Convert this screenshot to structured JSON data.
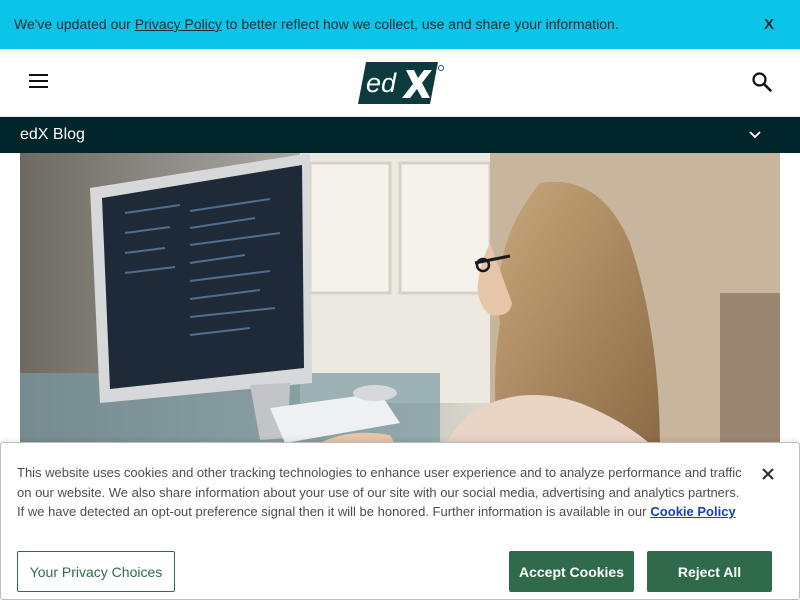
{
  "notice": {
    "text_before": "We've updated our ",
    "link": "Privacy Policy",
    "text_after": " to better reflect how we collect, use and share your information.",
    "close": "X"
  },
  "header": {
    "menu_icon": "hamburger-icon",
    "logo": "edX",
    "search_icon": "search-icon"
  },
  "blog_bar": {
    "title": "edX Blog",
    "chevron_icon": "chevron-down-icon"
  },
  "hero": {
    "icon": "photo-of-woman-at-computer"
  },
  "consent": {
    "text": "This website uses cookies and other tracking technologies to enhance user experience and to analyze performance and traffic on our website. We also share information about your use of our site with our social media, advertising and analytics partners. If we have detected an opt-out preference signal then it will be honored. Further information is available in our",
    "link": "Cookie Policy",
    "close_icon": "close-icon",
    "btn_choices": "Your Privacy Choices",
    "btn_accept": "Accept Cookies",
    "btn_reject": "Reject All"
  },
  "colors": {
    "notice_bg": "#0bc5e8",
    "blog_bar_bg": "#00262b",
    "button_green": "#2f6b4a",
    "link_blue": "#1a3fb5"
  }
}
